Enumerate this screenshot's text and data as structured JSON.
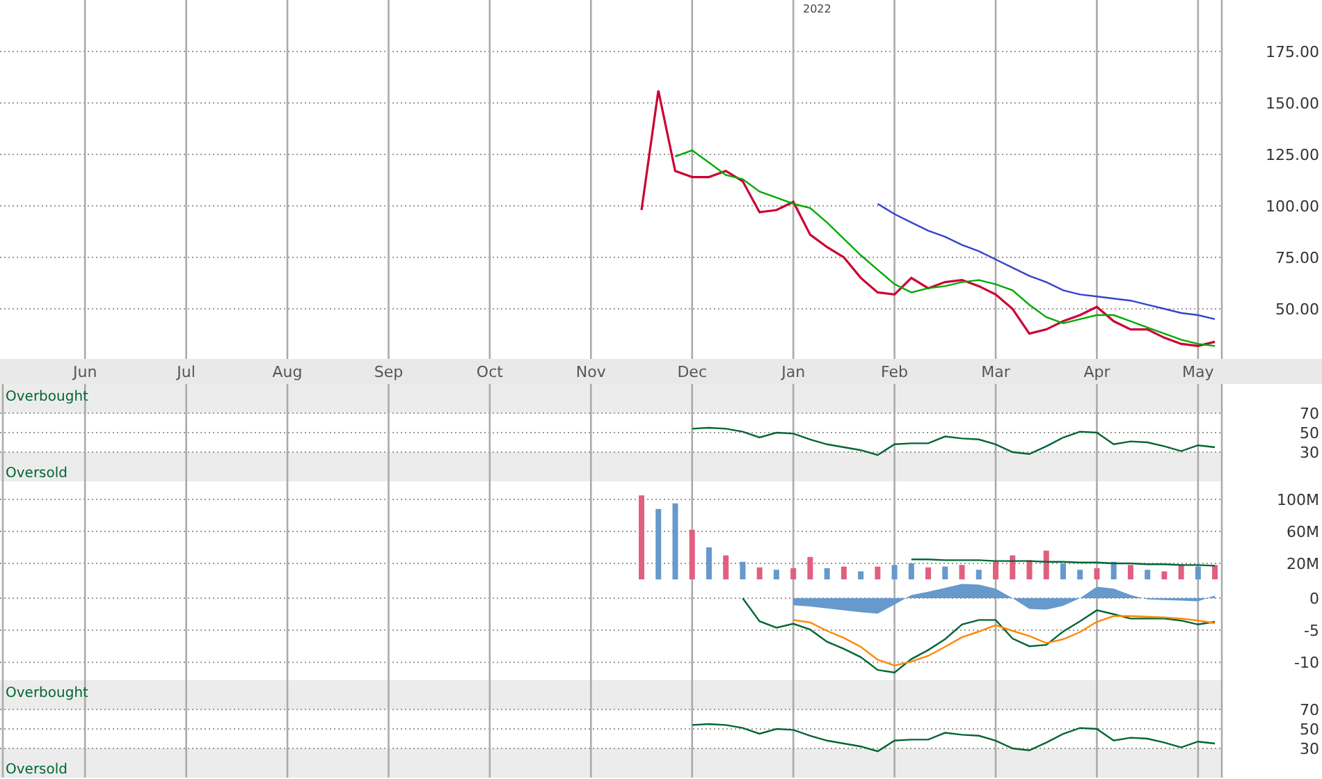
{
  "panels": [
    {
      "kind": "price",
      "chart_data": {
        "type": "line",
        "grid": true,
        "ylim": [
          25.7,
          200
        ],
        "categories": [
          null,
          null,
          null,
          null,
          null,
          "Jun",
          null,
          null,
          null,
          null,
          null,
          "Jul",
          null,
          null,
          null,
          null,
          null,
          "Aug",
          null,
          null,
          null,
          null,
          null,
          "Sep",
          null,
          null,
          null,
          null,
          null,
          "Oct",
          null,
          null,
          null,
          null,
          null,
          "Nov",
          null,
          null,
          null,
          null,
          null,
          "Dec",
          null,
          null,
          null,
          null,
          null,
          "Jan",
          null,
          null,
          null,
          null,
          null,
          "Feb",
          null,
          null,
          null,
          null,
          null,
          "Mar",
          null,
          null,
          null,
          null,
          null,
          "Apr",
          null,
          null,
          null,
          null,
          null,
          "May",
          null
        ],
        "yticks": [
          {
            "value": 50,
            "label": "50.00"
          },
          {
            "value": 75,
            "label": "75.00"
          },
          {
            "value": 100,
            "label": "100.00"
          },
          {
            "value": 125,
            "label": "125.00"
          },
          {
            "value": 150,
            "label": "150.00"
          },
          {
            "value": 175,
            "label": "175.00"
          }
        ],
        "annotations": [
          "2022"
        ],
        "series": [
          {
            "color": "#cc0033",
            "values": [
              null,
              null,
              null,
              null,
              null,
              null,
              null,
              null,
              null,
              null,
              null,
              null,
              null,
              null,
              null,
              null,
              null,
              null,
              null,
              null,
              null,
              null,
              null,
              null,
              null,
              null,
              null,
              null,
              null,
              null,
              null,
              null,
              null,
              null,
              null,
              null,
              null,
              null,
              98,
              156,
              117,
              114,
              114,
              117,
              112,
              97,
              98,
              102,
              86,
              80,
              75,
              65,
              58,
              57,
              65,
              60,
              63,
              64,
              61,
              57,
              50,
              38,
              40,
              44,
              47,
              51,
              44,
              40,
              40,
              36,
              33,
              32,
              34
            ]
          },
          {
            "color": "#00aa00",
            "values": [
              null,
              null,
              null,
              null,
              null,
              null,
              null,
              null,
              null,
              null,
              null,
              null,
              null,
              null,
              null,
              null,
              null,
              null,
              null,
              null,
              null,
              null,
              null,
              null,
              null,
              null,
              null,
              null,
              null,
              null,
              null,
              null,
              null,
              null,
              null,
              null,
              null,
              null,
              null,
              null,
              124,
              127,
              121,
              115,
              113,
              107,
              104,
              101,
              99,
              92,
              84,
              76,
              69,
              62,
              58,
              60,
              61,
              63,
              64,
              62,
              59,
              52,
              46,
              43,
              45,
              47,
              47,
              44,
              41,
              38,
              35,
              33,
              32
            ]
          },
          {
            "color": "#3344cc",
            "values": [
              null,
              null,
              null,
              null,
              null,
              null,
              null,
              null,
              null,
              null,
              null,
              null,
              null,
              null,
              null,
              null,
              null,
              null,
              null,
              null,
              null,
              null,
              null,
              null,
              null,
              null,
              null,
              null,
              null,
              null,
              null,
              null,
              null,
              null,
              null,
              null,
              null,
              null,
              null,
              null,
              null,
              null,
              null,
              null,
              null,
              null,
              null,
              null,
              null,
              null,
              null,
              null,
              101,
              96,
              92,
              88,
              85,
              81,
              78,
              74,
              70,
              66,
              63,
              59,
              57,
              56,
              55,
              54,
              52,
              50,
              48,
              47,
              45
            ]
          }
        ]
      }
    },
    {
      "kind": "rsi",
      "overbought_label": "Overbought",
      "oversold_label": "Oversold",
      "chart_data": {
        "type": "line",
        "grid": true,
        "ylim": [
          0,
          100
        ],
        "categories": [
          null,
          null,
          null,
          null,
          null,
          null,
          null,
          null,
          null,
          null,
          null,
          null,
          null,
          null,
          null,
          null,
          null,
          null,
          null,
          null,
          null,
          null,
          null,
          null,
          null,
          null,
          null,
          null,
          null,
          null,
          null,
          null,
          null,
          null,
          null,
          null,
          null,
          null,
          null,
          null,
          null,
          null,
          null,
          null,
          null,
          null,
          null,
          null,
          null,
          null,
          null,
          null,
          null,
          null,
          null,
          null,
          null,
          null,
          null,
          null,
          null,
          null,
          null,
          null,
          null,
          null,
          null,
          null,
          null,
          null,
          null,
          null,
          null
        ],
        "yticks": [
          {
            "value": 30,
            "label": "30"
          },
          {
            "value": 50,
            "label": "50"
          },
          {
            "value": 70,
            "label": "70"
          }
        ],
        "series": [
          {
            "color": "#006633",
            "values": [
              null,
              null,
              null,
              null,
              null,
              null,
              null,
              null,
              null,
              null,
              null,
              null,
              null,
              null,
              null,
              null,
              null,
              null,
              null,
              null,
              null,
              null,
              null,
              null,
              null,
              null,
              null,
              null,
              null,
              null,
              null,
              null,
              null,
              null,
              null,
              null,
              null,
              null,
              null,
              null,
              null,
              54,
              55,
              54,
              51,
              45,
              50,
              49,
              43,
              38,
              35,
              32,
              27,
              38,
              39,
              39,
              46,
              44,
              43,
              38,
              30,
              28,
              36,
              45,
              51,
              50,
              38,
              41,
              40,
              36,
              31,
              37,
              35
            ]
          }
        ]
      }
    },
    {
      "kind": "volume",
      "chart_data": {
        "type": "bar",
        "grid": true,
        "ylim": [
          -2.6,
          122.6
        ],
        "categories": [
          null,
          null,
          null,
          null,
          null,
          null,
          null,
          null,
          null,
          null,
          null,
          null,
          null,
          null,
          null,
          null,
          null,
          null,
          null,
          null,
          null,
          null,
          null,
          null,
          null,
          null,
          null,
          null,
          null,
          null,
          null,
          null,
          null,
          null,
          null,
          null,
          null,
          null,
          null,
          null,
          null,
          null,
          null,
          null,
          null,
          null,
          null,
          null,
          null,
          null,
          null,
          null,
          null,
          null,
          null,
          null,
          null,
          null,
          null,
          null,
          null,
          null,
          null,
          null,
          null,
          null,
          null,
          null,
          null,
          null,
          null,
          null,
          null
        ],
        "yticks": [
          {
            "value": 20,
            "label": "20M"
          },
          {
            "value": 60,
            "label": "60M"
          },
          {
            "value": 100,
            "label": "100M"
          }
        ],
        "series": [
          {
            "color": "#6699cc",
            "values": [
              null,
              null,
              null,
              null,
              null,
              null,
              null,
              null,
              null,
              null,
              null,
              null,
              null,
              null,
              null,
              null,
              null,
              null,
              null,
              null,
              null,
              null,
              null,
              null,
              null,
              null,
              null,
              null,
              null,
              null,
              null,
              null,
              null,
              null,
              null,
              null,
              null,
              null,
              null,
              88,
              95,
              null,
              40,
              null,
              22,
              null,
              12,
              null,
              null,
              14,
              null,
              10,
              null,
              18,
              20,
              null,
              16,
              null,
              12,
              null,
              null,
              null,
              null,
              20,
              12,
              null,
              22,
              null,
              12,
              null,
              null,
              16,
              null
            ]
          },
          {
            "color": "#e0607e",
            "values": [
              null,
              null,
              null,
              null,
              null,
              null,
              null,
              null,
              null,
              null,
              null,
              null,
              null,
              null,
              null,
              null,
              null,
              null,
              null,
              null,
              null,
              null,
              null,
              null,
              null,
              null,
              null,
              null,
              null,
              null,
              null,
              null,
              null,
              null,
              null,
              null,
              null,
              null,
              105,
              null,
              null,
              62,
              null,
              30,
              null,
              15,
              null,
              14,
              28,
              null,
              16,
              null,
              16,
              null,
              null,
              15,
              null,
              18,
              null,
              22,
              30,
              24,
              36,
              null,
              null,
              14,
              null,
              18,
              null,
              10,
              18,
              null,
              18
            ]
          },
          {
            "color": "#006633",
            "type": "line",
            "values": [
              null,
              null,
              null,
              null,
              null,
              null,
              null,
              null,
              null,
              null,
              null,
              null,
              null,
              null,
              null,
              null,
              null,
              null,
              null,
              null,
              null,
              null,
              null,
              null,
              null,
              null,
              null,
              null,
              null,
              null,
              null,
              null,
              null,
              null,
              null,
              null,
              null,
              null,
              null,
              null,
              null,
              null,
              null,
              null,
              null,
              null,
              null,
              null,
              null,
              null,
              null,
              null,
              null,
              null,
              25,
              25,
              24,
              24,
              24,
              23,
              23,
              23,
              22,
              22,
              21,
              21,
              20,
              20,
              19,
              19,
              18,
              18,
              17
            ]
          }
        ]
      }
    },
    {
      "kind": "macd",
      "chart_data": {
        "type": "line",
        "grid": true,
        "ylim": [
          -12.8,
          2.6
        ],
        "categories": [
          null,
          null,
          null,
          null,
          null,
          null,
          null,
          null,
          null,
          null,
          null,
          null,
          null,
          null,
          null,
          null,
          null,
          null,
          null,
          null,
          null,
          null,
          null,
          null,
          null,
          null,
          null,
          null,
          null,
          null,
          null,
          null,
          null,
          null,
          null,
          null,
          null,
          null,
          null,
          null,
          null,
          null,
          null,
          null,
          null,
          null,
          null,
          null,
          null,
          null,
          null,
          null,
          null,
          null,
          null,
          null,
          null,
          null,
          null,
          null,
          null,
          null,
          null,
          null,
          null,
          null,
          null,
          null,
          null,
          null,
          null,
          null,
          null
        ],
        "yticks": [
          {
            "value": -10,
            "label": "-10"
          },
          {
            "value": -5,
            "label": "-5"
          },
          {
            "value": 0,
            "label": "0"
          }
        ],
        "series": [
          {
            "color": "#6699cc",
            "type": "area",
            "values": [
              null,
              null,
              null,
              null,
              null,
              null,
              null,
              null,
              null,
              null,
              null,
              null,
              null,
              null,
              null,
              null,
              null,
              null,
              null,
              null,
              null,
              null,
              null,
              null,
              null,
              null,
              null,
              null,
              null,
              null,
              null,
              null,
              null,
              null,
              null,
              null,
              null,
              null,
              null,
              null,
              null,
              null,
              null,
              null,
              null,
              null,
              null,
              -1.1,
              -1.3,
              -1.6,
              -1.9,
              -2.2,
              -2.4,
              -1,
              0.5,
              1,
              1.6,
              2.2,
              2.1,
              1.5,
              0,
              -1.7,
              -1.8,
              -1.2,
              0,
              1.8,
              1.5,
              0.5,
              -0.2,
              -0.3,
              -0.4,
              -0.5,
              0.4
            ]
          },
          {
            "color": "#006633",
            "values": [
              null,
              null,
              null,
              null,
              null,
              null,
              null,
              null,
              null,
              null,
              null,
              null,
              null,
              null,
              null,
              null,
              null,
              null,
              null,
              null,
              null,
              null,
              null,
              null,
              null,
              null,
              null,
              null,
              null,
              null,
              null,
              null,
              null,
              null,
              null,
              null,
              null,
              null,
              null,
              null,
              null,
              null,
              null,
              null,
              0,
              -3.6,
              -4.6,
              -4,
              -4.9,
              -6.8,
              -7.9,
              -9.2,
              -11.2,
              -11.6,
              -9.5,
              -8.1,
              -6.4,
              -4.1,
              -3.4,
              -3.4,
              -6.3,
              -7.5,
              -7.3,
              -5.2,
              -3.6,
              -1.9,
              -2.5,
              -3.2,
              -3.2,
              -3.2,
              -3.5,
              -4.1,
              -3.7
            ]
          },
          {
            "color": "#ff8800",
            "values": [
              null,
              null,
              null,
              null,
              null,
              null,
              null,
              null,
              null,
              null,
              null,
              null,
              null,
              null,
              null,
              null,
              null,
              null,
              null,
              null,
              null,
              null,
              null,
              null,
              null,
              null,
              null,
              null,
              null,
              null,
              null,
              null,
              null,
              null,
              null,
              null,
              null,
              null,
              null,
              null,
              null,
              null,
              null,
              null,
              null,
              null,
              null,
              -3.4,
              -3.8,
              -5.1,
              -6.2,
              -7.6,
              -9.6,
              -10.5,
              -9.9,
              -9,
              -7.6,
              -6.1,
              -5.2,
              -4.2,
              -5.1,
              -5.9,
              -7,
              -6.4,
              -5.3,
              -3.7,
              -2.8,
              -2.8,
              -2.9,
              -3,
              -3.2,
              -3.5,
              -3.9
            ]
          }
        ]
      }
    },
    {
      "kind": "rsi",
      "overbought_label": "Overbought",
      "oversold_label": "Oversold",
      "chart_data": {
        "type": "line",
        "grid": true,
        "ylim": [
          0,
          100
        ],
        "categories": [
          null,
          null,
          null,
          null,
          null,
          null,
          null,
          null,
          null,
          null,
          null,
          null,
          null,
          null,
          null,
          null,
          null,
          null,
          null,
          null,
          null,
          null,
          null,
          null,
          null,
          null,
          null,
          null,
          null,
          null,
          null,
          null,
          null,
          null,
          null,
          null,
          null,
          null,
          null,
          null,
          null,
          null,
          null,
          null,
          null,
          null,
          null,
          null,
          null,
          null,
          null,
          null,
          null,
          null,
          null,
          null,
          null,
          null,
          null,
          null,
          null,
          null,
          null,
          null,
          null,
          null,
          null,
          null,
          null,
          null,
          null,
          null,
          null
        ],
        "yticks": [
          {
            "value": 30,
            "label": "30"
          },
          {
            "value": 50,
            "label": "50"
          },
          {
            "value": 70,
            "label": "70"
          }
        ],
        "series": [
          {
            "color": "#006633",
            "values": [
              null,
              null,
              null,
              null,
              null,
              null,
              null,
              null,
              null,
              null,
              null,
              null,
              null,
              null,
              null,
              null,
              null,
              null,
              null,
              null,
              null,
              null,
              null,
              null,
              null,
              null,
              null,
              null,
              null,
              null,
              null,
              null,
              null,
              null,
              null,
              null,
              null,
              null,
              null,
              null,
              null,
              54,
              55,
              54,
              51,
              45,
              50,
              49,
              43,
              38,
              35,
              32,
              27,
              38,
              39,
              39,
              46,
              44,
              43,
              38,
              30,
              28,
              36,
              45,
              51,
              50,
              38,
              41,
              40,
              36,
              31,
              37,
              35
            ]
          }
        ]
      }
    }
  ]
}
